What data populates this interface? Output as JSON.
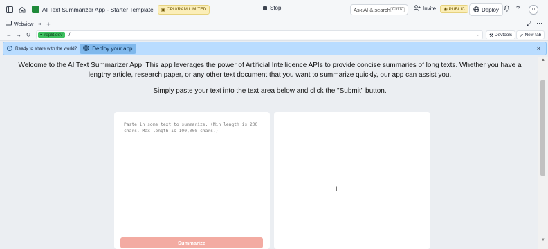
{
  "topbar": {
    "app_title": "AI Text Summarizer App - Starter Template",
    "limit_badge": "CPU/RAM LIMITED",
    "stop_label": "Stop",
    "ask_ai_label": "Ask AI & search",
    "ask_ai_shortcut": "Ctrl K",
    "invite_label": "Invite",
    "public_badge": "PUBLIC",
    "deploy_label": "Deploy",
    "help_label": "?",
    "avatar_initials": "U"
  },
  "tabbar": {
    "tab_label": "Webview",
    "tab_close": "×",
    "add_tab": "+",
    "more": "···"
  },
  "urlbar": {
    "domain": ".replit.dev",
    "path": "/",
    "devtools_label": "Devtools",
    "newtab_label": "New tab"
  },
  "banner": {
    "text": "Ready to share with the world?",
    "deploy_button": "Deploy your app",
    "close": "×"
  },
  "main": {
    "intro": "Welcome to the AI Text Summarizer App! This app leverages the power of Artificial Intelligence APIs to provide concise summaries of long texts. Whether you have a lengthy article, research paper, or any other text document that you want to summarize quickly, our app can assist you.",
    "instruction": "Simply paste your text into the text area below and click the \"Submit\" button.",
    "textarea_placeholder": "Paste in some text to summarize. (Min length is 200 chars. Max length is 100,000 chars.)",
    "submit_label": "Summarize"
  },
  "colors": {
    "submit_bg": "#f3aba2",
    "banner_bg": "#b9dcff",
    "badge_bg": "#fbeeb8"
  }
}
